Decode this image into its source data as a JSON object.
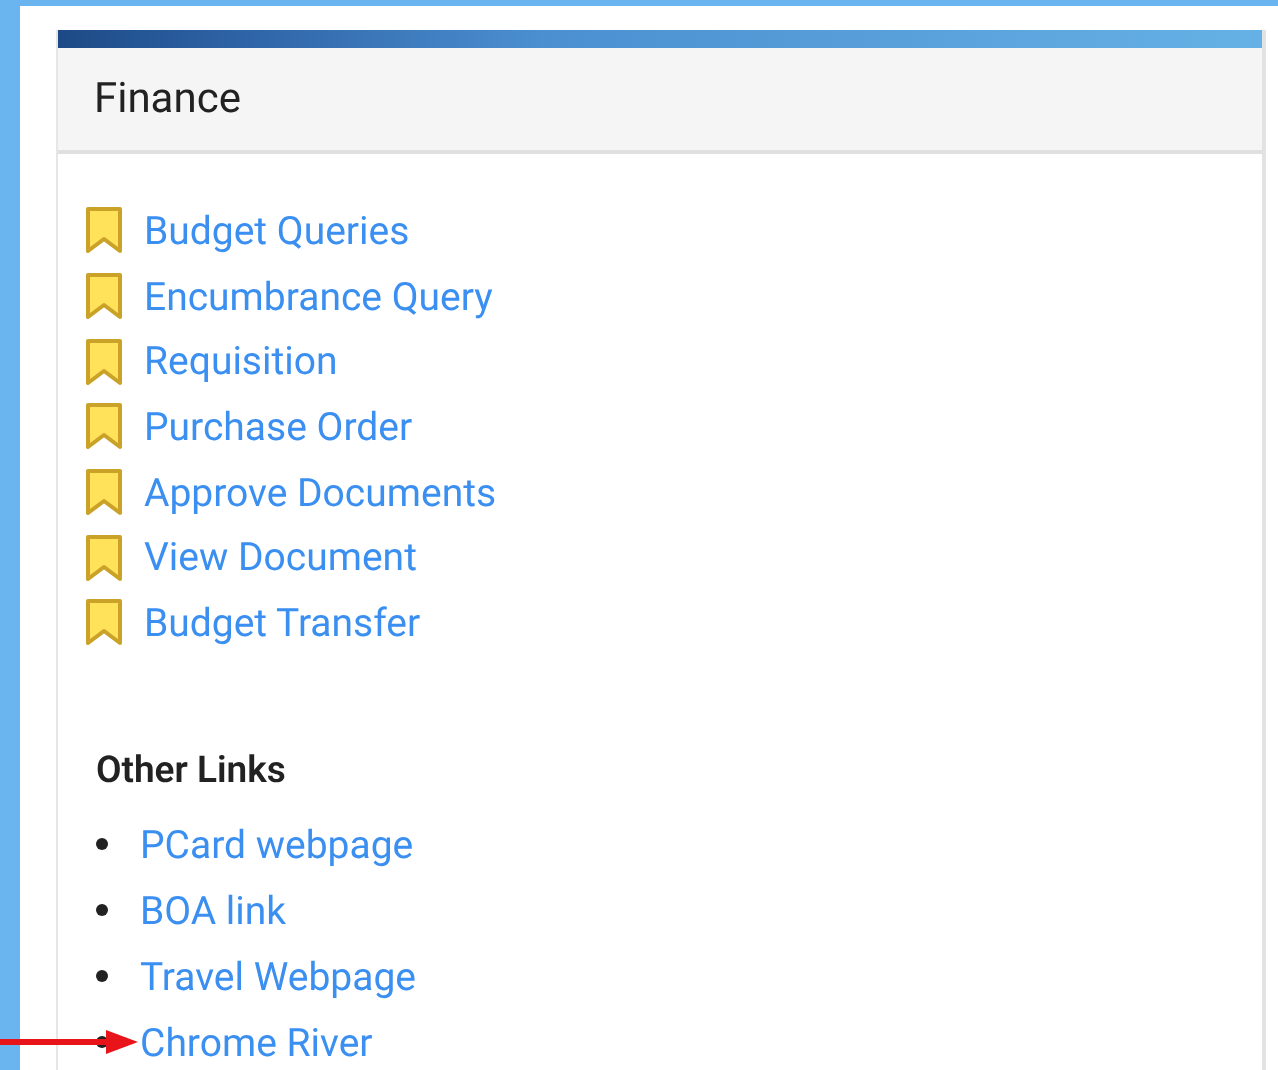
{
  "panel": {
    "title": "Finance"
  },
  "bookmarks": [
    {
      "label": "Budget Queries"
    },
    {
      "label": "Encumbrance Query"
    },
    {
      "label": "Requisition"
    },
    {
      "label": "Purchase Order"
    },
    {
      "label": "Approve Documents"
    },
    {
      "label": "View Document"
    },
    {
      "label": "Budget Transfer"
    }
  ],
  "other_links": {
    "heading": "Other Links",
    "links": [
      {
        "label": "PCard webpage"
      },
      {
        "label": "BOA link"
      },
      {
        "label": "Travel Webpage"
      },
      {
        "label": "Chrome River",
        "kind": "pointed"
      }
    ]
  }
}
